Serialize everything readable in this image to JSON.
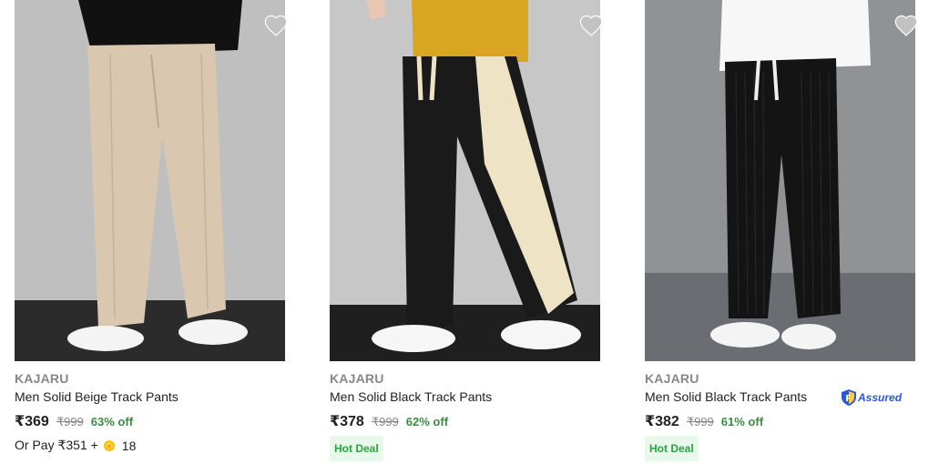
{
  "products": [
    {
      "brand": "KAJARU",
      "title": "Men Solid Beige Track Pants",
      "price": "₹369",
      "mrp": "₹999",
      "discount": "63% off",
      "pay_prefix": "Or Pay ₹351 +",
      "pay_coins": "18",
      "image_icon": "beige-track-pants-image",
      "pants_color": "#d9c7b0",
      "stripe_color": "",
      "top_color": "#111111",
      "bg_color": "#bfbfbf",
      "floor_color": "#2b2b2b"
    },
    {
      "brand": "KAJARU",
      "title": "Men Solid Black Track Pants",
      "price": "₹378",
      "mrp": "₹999",
      "discount": "62% off",
      "badge": "Hot Deal",
      "image_icon": "black-cream-stripe-track-pants-image",
      "pants_color": "#1a1a1a",
      "stripe_color": "#efe3c6",
      "top_color": "#d9a621",
      "bg_color": "#c7c7c7",
      "floor_color": "#1f1f1f"
    },
    {
      "brand": "KAJARU",
      "title": "Men Solid Black Track Pants",
      "price": "₹382",
      "mrp": "₹999",
      "discount": "61% off",
      "badge": "Hot Deal",
      "assured_label": "Assured",
      "image_icon": "black-corduroy-track-pants-image",
      "pants_color": "#141414",
      "stripe_color": "",
      "top_color": "#f7f7f7",
      "bg_color": "#8f9396",
      "floor_color": "#6a6e72"
    }
  ],
  "colors": {
    "discount_green": "#388e3c",
    "hot_deal_green": "#26a541",
    "hot_deal_bg": "#e8f9ec",
    "assured_blue": "#2a55e5",
    "muted_gray": "#878787",
    "wishlist_gray": "#c2c2c2"
  },
  "icons": {
    "wishlist": "heart-icon",
    "coin": "supercoin-icon",
    "assured": "assured-shield-icon"
  }
}
